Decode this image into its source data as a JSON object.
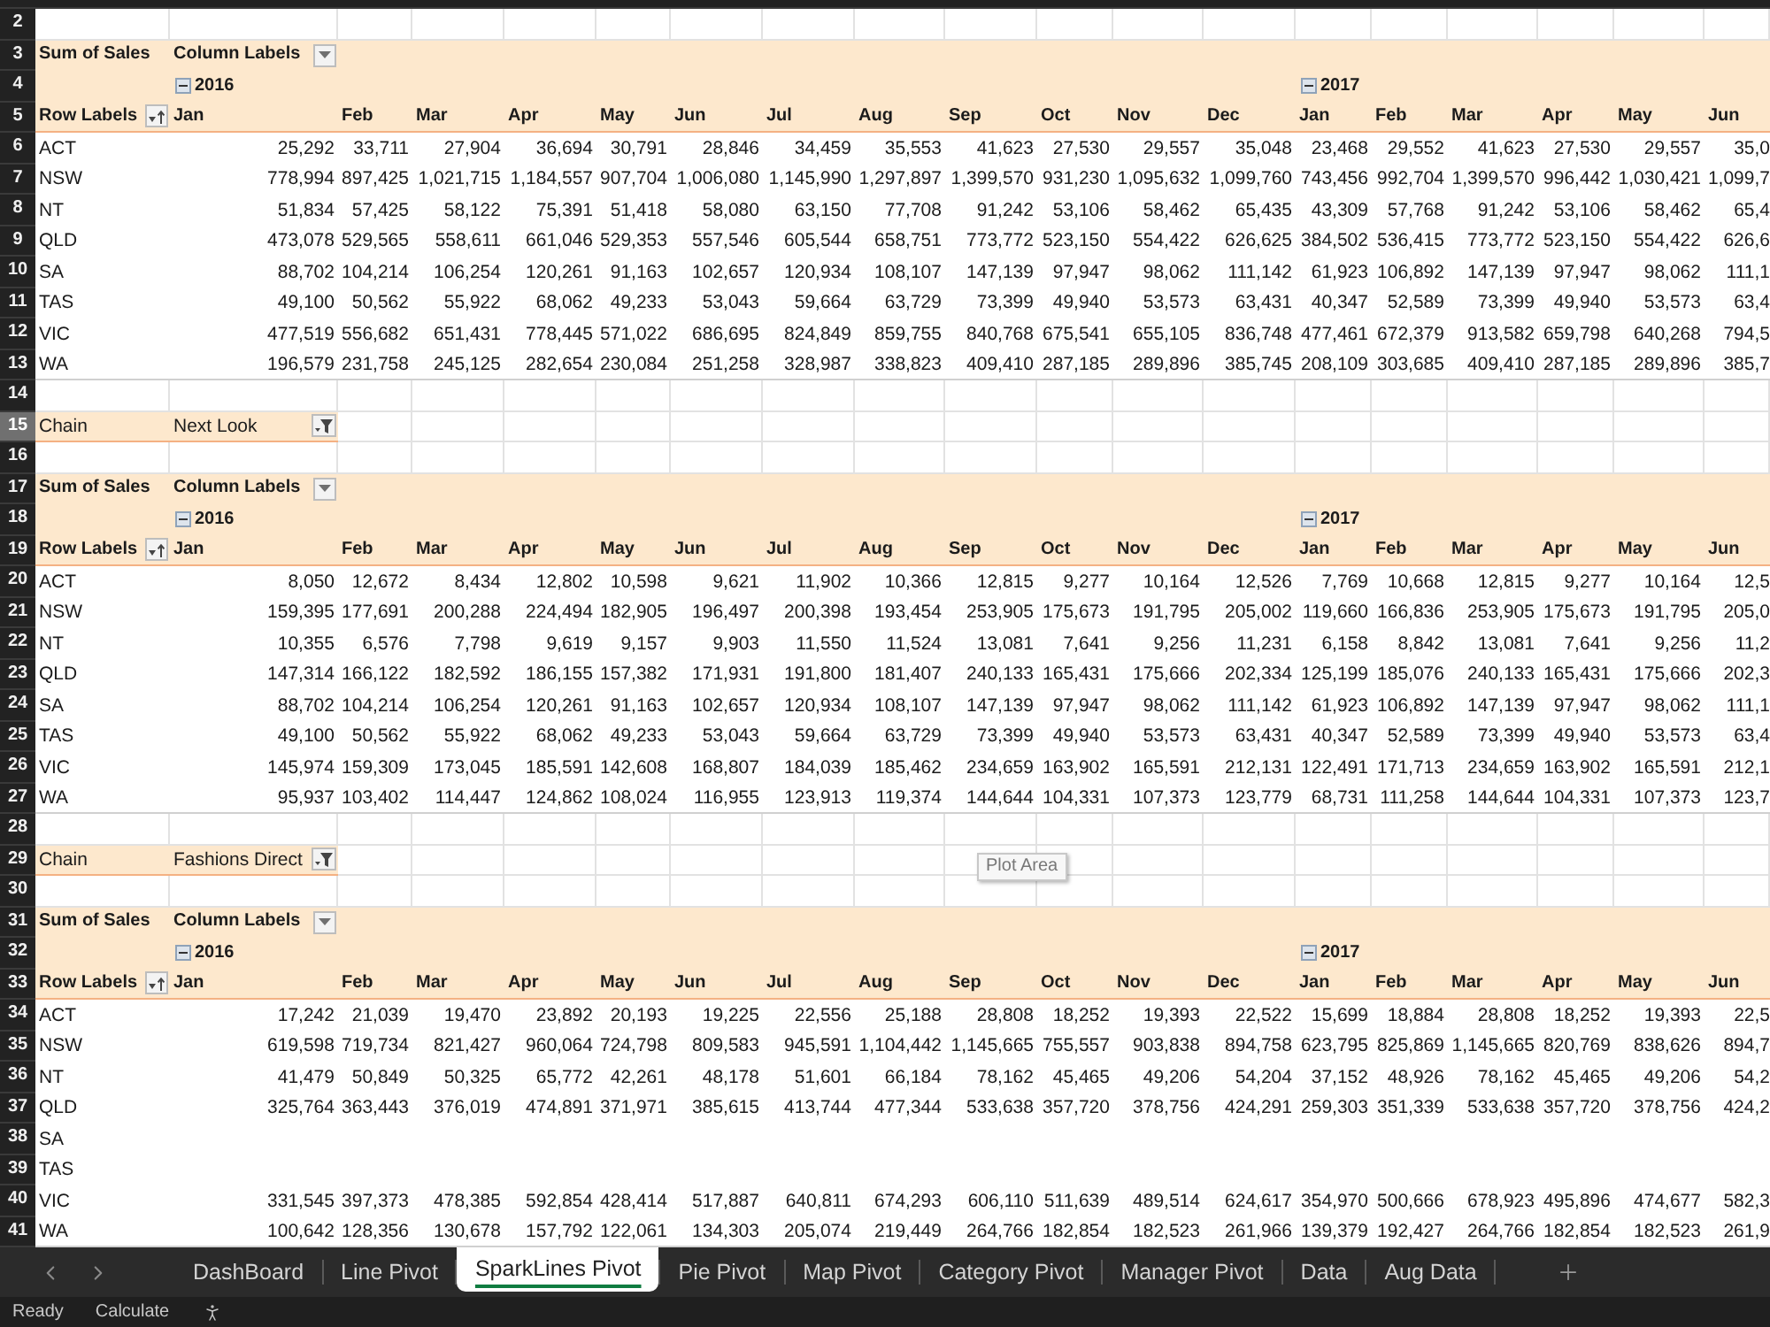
{
  "row_headers": [
    {
      "label": "2",
      "selected": false
    },
    {
      "label": "3",
      "selected": false
    },
    {
      "label": "4",
      "selected": false
    },
    {
      "label": "5",
      "selected": false
    },
    {
      "label": "6",
      "selected": false
    },
    {
      "label": "7",
      "selected": false
    },
    {
      "label": "8",
      "selected": false
    },
    {
      "label": "9",
      "selected": false
    },
    {
      "label": "10",
      "selected": false
    },
    {
      "label": "11",
      "selected": false
    },
    {
      "label": "12",
      "selected": false
    },
    {
      "label": "13",
      "selected": false
    },
    {
      "label": "14",
      "selected": false
    },
    {
      "label": "15",
      "selected": true
    },
    {
      "label": "16",
      "selected": false
    },
    {
      "label": "17",
      "selected": false
    },
    {
      "label": "18",
      "selected": false
    },
    {
      "label": "19",
      "selected": false
    },
    {
      "label": "20",
      "selected": false
    },
    {
      "label": "21",
      "selected": false
    },
    {
      "label": "22",
      "selected": false
    },
    {
      "label": "23",
      "selected": false
    },
    {
      "label": "24",
      "selected": false
    },
    {
      "label": "25",
      "selected": false
    },
    {
      "label": "26",
      "selected": false
    },
    {
      "label": "27",
      "selected": false
    },
    {
      "label": "28",
      "selected": false
    },
    {
      "label": "29",
      "selected": false
    },
    {
      "label": "30",
      "selected": false
    },
    {
      "label": "31",
      "selected": false
    },
    {
      "label": "32",
      "selected": false
    },
    {
      "label": "33",
      "selected": false
    },
    {
      "label": "34",
      "selected": false
    },
    {
      "label": "35",
      "selected": false
    },
    {
      "label": "36",
      "selected": false
    },
    {
      "label": "37",
      "selected": false
    },
    {
      "label": "38",
      "selected": false
    },
    {
      "label": "39",
      "selected": false
    },
    {
      "label": "40",
      "selected": false
    },
    {
      "label": "41",
      "selected": false
    }
  ],
  "blocks": [
    {
      "kind": "pivot",
      "title": "Sum of Sales",
      "column_labels": "Column Labels",
      "row_labels": "Row Labels",
      "years": [
        {
          "label": "2016",
          "expanded": true,
          "months": [
            "Jan",
            "Feb",
            "Mar",
            "Apr",
            "May",
            "Jun",
            "Jul",
            "Aug",
            "Sep",
            "Oct",
            "Nov",
            "Dec"
          ]
        },
        {
          "label": "2017",
          "expanded": true,
          "months": [
            "Jan",
            "Feb",
            "Mar",
            "Apr",
            "May",
            "Jun"
          ]
        }
      ],
      "rows": [
        {
          "label": "ACT",
          "values": [
            "25,292",
            "33,711",
            "27,904",
            "36,694",
            "30,791",
            "28,846",
            "34,459",
            "35,553",
            "41,623",
            "27,530",
            "29,557",
            "35,048",
            "23,468",
            "29,552",
            "41,623",
            "27,530",
            "29,557",
            "35,0"
          ]
        },
        {
          "label": "NSW",
          "values": [
            "778,994",
            "897,425",
            "1,021,715",
            "1,184,557",
            "907,704",
            "1,006,080",
            "1,145,990",
            "1,297,897",
            "1,399,570",
            "931,230",
            "1,095,632",
            "1,099,760",
            "743,456",
            "992,704",
            "1,399,570",
            "996,442",
            "1,030,421",
            "1,099,7"
          ]
        },
        {
          "label": "NT",
          "values": [
            "51,834",
            "57,425",
            "58,122",
            "75,391",
            "51,418",
            "58,080",
            "63,150",
            "77,708",
            "91,242",
            "53,106",
            "58,462",
            "65,435",
            "43,309",
            "57,768",
            "91,242",
            "53,106",
            "58,462",
            "65,4"
          ]
        },
        {
          "label": "QLD",
          "values": [
            "473,078",
            "529,565",
            "558,611",
            "661,046",
            "529,353",
            "557,546",
            "605,544",
            "658,751",
            "773,772",
            "523,150",
            "554,422",
            "626,625",
            "384,502",
            "536,415",
            "773,772",
            "523,150",
            "554,422",
            "626,6"
          ]
        },
        {
          "label": "SA",
          "values": [
            "88,702",
            "104,214",
            "106,254",
            "120,261",
            "91,163",
            "102,657",
            "120,934",
            "108,107",
            "147,139",
            "97,947",
            "98,062",
            "111,142",
            "61,923",
            "106,892",
            "147,139",
            "97,947",
            "98,062",
            "111,1"
          ]
        },
        {
          "label": "TAS",
          "values": [
            "49,100",
            "50,562",
            "55,922",
            "68,062",
            "49,233",
            "53,043",
            "59,664",
            "63,729",
            "73,399",
            "49,940",
            "53,573",
            "63,431",
            "40,347",
            "52,589",
            "73,399",
            "49,940",
            "53,573",
            "63,4"
          ]
        },
        {
          "label": "VIC",
          "values": [
            "477,519",
            "556,682",
            "651,431",
            "778,445",
            "571,022",
            "686,695",
            "824,849",
            "859,755",
            "840,768",
            "675,541",
            "655,105",
            "836,748",
            "477,461",
            "672,379",
            "913,582",
            "659,798",
            "640,268",
            "794,5"
          ]
        },
        {
          "label": "WA",
          "values": [
            "196,579",
            "231,758",
            "245,125",
            "282,654",
            "230,084",
            "251,258",
            "328,987",
            "338,823",
            "409,410",
            "287,185",
            "289,896",
            "385,745",
            "208,109",
            "303,685",
            "409,410",
            "287,185",
            "289,896",
            "385,7"
          ]
        }
      ]
    },
    {
      "kind": "filter",
      "field": "Chain",
      "value": "Next Look"
    },
    {
      "kind": "pivot",
      "title": "Sum of Sales",
      "column_labels": "Column Labels",
      "row_labels": "Row Labels",
      "years": [
        {
          "label": "2016",
          "expanded": true,
          "months": [
            "Jan",
            "Feb",
            "Mar",
            "Apr",
            "May",
            "Jun",
            "Jul",
            "Aug",
            "Sep",
            "Oct",
            "Nov",
            "Dec"
          ]
        },
        {
          "label": "2017",
          "expanded": true,
          "months": [
            "Jan",
            "Feb",
            "Mar",
            "Apr",
            "May",
            "Jun"
          ]
        }
      ],
      "rows": [
        {
          "label": "ACT",
          "values": [
            "8,050",
            "12,672",
            "8,434",
            "12,802",
            "10,598",
            "9,621",
            "11,902",
            "10,366",
            "12,815",
            "9,277",
            "10,164",
            "12,526",
            "7,769",
            "10,668",
            "12,815",
            "9,277",
            "10,164",
            "12,5"
          ]
        },
        {
          "label": "NSW",
          "values": [
            "159,395",
            "177,691",
            "200,288",
            "224,494",
            "182,905",
            "196,497",
            "200,398",
            "193,454",
            "253,905",
            "175,673",
            "191,795",
            "205,002",
            "119,660",
            "166,836",
            "253,905",
            "175,673",
            "191,795",
            "205,0"
          ]
        },
        {
          "label": "NT",
          "values": [
            "10,355",
            "6,576",
            "7,798",
            "9,619",
            "9,157",
            "9,903",
            "11,550",
            "11,524",
            "13,081",
            "7,641",
            "9,256",
            "11,231",
            "6,158",
            "8,842",
            "13,081",
            "7,641",
            "9,256",
            "11,2"
          ]
        },
        {
          "label": "QLD",
          "values": [
            "147,314",
            "166,122",
            "182,592",
            "186,155",
            "157,382",
            "171,931",
            "191,800",
            "181,407",
            "240,133",
            "165,431",
            "175,666",
            "202,334",
            "125,199",
            "185,076",
            "240,133",
            "165,431",
            "175,666",
            "202,3"
          ]
        },
        {
          "label": "SA",
          "values": [
            "88,702",
            "104,214",
            "106,254",
            "120,261",
            "91,163",
            "102,657",
            "120,934",
            "108,107",
            "147,139",
            "97,947",
            "98,062",
            "111,142",
            "61,923",
            "106,892",
            "147,139",
            "97,947",
            "98,062",
            "111,1"
          ]
        },
        {
          "label": "TAS",
          "values": [
            "49,100",
            "50,562",
            "55,922",
            "68,062",
            "49,233",
            "53,043",
            "59,664",
            "63,729",
            "73,399",
            "49,940",
            "53,573",
            "63,431",
            "40,347",
            "52,589",
            "73,399",
            "49,940",
            "53,573",
            "63,4"
          ]
        },
        {
          "label": "VIC",
          "values": [
            "145,974",
            "159,309",
            "173,045",
            "185,591",
            "142,608",
            "168,807",
            "184,039",
            "185,462",
            "234,659",
            "163,902",
            "165,591",
            "212,131",
            "122,491",
            "171,713",
            "234,659",
            "163,902",
            "165,591",
            "212,1"
          ]
        },
        {
          "label": "WA",
          "values": [
            "95,937",
            "103,402",
            "114,447",
            "124,862",
            "108,024",
            "116,955",
            "123,913",
            "119,374",
            "144,644",
            "104,331",
            "107,373",
            "123,779",
            "68,731",
            "111,258",
            "144,644",
            "104,331",
            "107,373",
            "123,7"
          ]
        }
      ]
    },
    {
      "kind": "filter",
      "field": "Chain",
      "value": "Fashions Direct"
    },
    {
      "kind": "pivot",
      "title": "Sum of Sales",
      "column_labels": "Column Labels",
      "row_labels": "Row Labels",
      "years": [
        {
          "label": "2016",
          "expanded": true,
          "months": [
            "Jan",
            "Feb",
            "Mar",
            "Apr",
            "May",
            "Jun",
            "Jul",
            "Aug",
            "Sep",
            "Oct",
            "Nov",
            "Dec"
          ]
        },
        {
          "label": "2017",
          "expanded": true,
          "months": [
            "Jan",
            "Feb",
            "Mar",
            "Apr",
            "May",
            "Jun"
          ]
        }
      ],
      "rows": [
        {
          "label": "ACT",
          "values": [
            "17,242",
            "21,039",
            "19,470",
            "23,892",
            "20,193",
            "19,225",
            "22,556",
            "25,188",
            "28,808",
            "18,252",
            "19,393",
            "22,522",
            "15,699",
            "18,884",
            "28,808",
            "18,252",
            "19,393",
            "22,5"
          ]
        },
        {
          "label": "NSW",
          "values": [
            "619,598",
            "719,734",
            "821,427",
            "960,064",
            "724,798",
            "809,583",
            "945,591",
            "1,104,442",
            "1,145,665",
            "755,557",
            "903,838",
            "894,758",
            "623,795",
            "825,869",
            "1,145,665",
            "820,769",
            "838,626",
            "894,7"
          ]
        },
        {
          "label": "NT",
          "values": [
            "41,479",
            "50,849",
            "50,325",
            "65,772",
            "42,261",
            "48,178",
            "51,601",
            "66,184",
            "78,162",
            "45,465",
            "49,206",
            "54,204",
            "37,152",
            "48,926",
            "78,162",
            "45,465",
            "49,206",
            "54,2"
          ]
        },
        {
          "label": "QLD",
          "values": [
            "325,764",
            "363,443",
            "376,019",
            "474,891",
            "371,971",
            "385,615",
            "413,744",
            "477,344",
            "533,638",
            "357,720",
            "378,756",
            "424,291",
            "259,303",
            "351,339",
            "533,638",
            "357,720",
            "378,756",
            "424,2"
          ]
        },
        {
          "label": "SA"
        },
        {
          "label": "TAS"
        },
        {
          "label": "VIC",
          "values": [
            "331,545",
            "397,373",
            "478,385",
            "592,854",
            "428,414",
            "517,887",
            "640,811",
            "674,293",
            "606,110",
            "511,639",
            "489,514",
            "624,617",
            "354,970",
            "500,666",
            "678,923",
            "495,896",
            "474,677",
            "582,3"
          ]
        },
        {
          "label": "WA",
          "values": [
            "100,642",
            "128,356",
            "130,678",
            "157,792",
            "122,061",
            "134,303",
            "205,074",
            "219,449",
            "264,766",
            "182,854",
            "182,523",
            "261,966",
            "139,379",
            "192,427",
            "264,766",
            "182,854",
            "182,523",
            "261,9"
          ]
        }
      ]
    }
  ],
  "tooltip": "Plot Area",
  "sheet_tabs": [
    {
      "label": "DashBoard",
      "selected": false
    },
    {
      "label": "Line Pivot",
      "selected": false
    },
    {
      "label": "SparkLines Pivot",
      "selected": true
    },
    {
      "label": "Pie Pivot",
      "selected": false
    },
    {
      "label": "Map Pivot",
      "selected": false
    },
    {
      "label": "Category Pivot",
      "selected": false
    },
    {
      "label": "Manager Pivot",
      "selected": false
    },
    {
      "label": "Data",
      "selected": false
    },
    {
      "label": "Aug Data",
      "selected": false
    }
  ],
  "status_bar": [
    "Ready",
    "Calculate"
  ]
}
